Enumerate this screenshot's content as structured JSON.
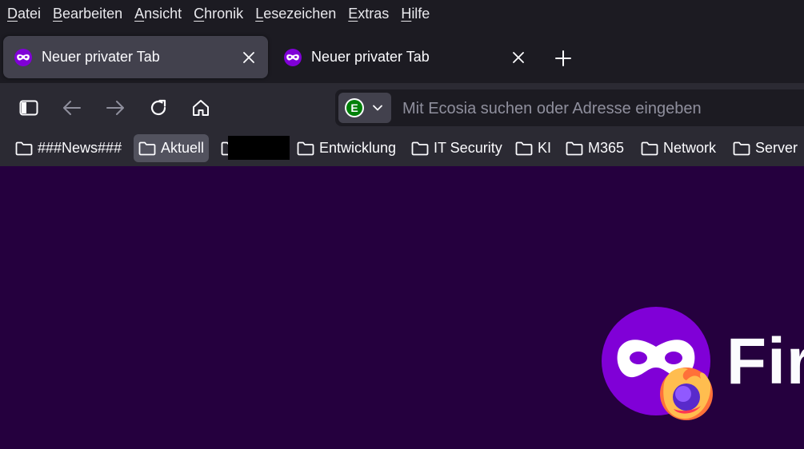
{
  "menubar": {
    "items": [
      {
        "accel": "D",
        "rest": "atei"
      },
      {
        "accel": "B",
        "rest": "earbeiten"
      },
      {
        "accel": "A",
        "rest": "nsicht"
      },
      {
        "accel": "C",
        "rest": "hronik"
      },
      {
        "accel": "L",
        "rest": "esezeichen"
      },
      {
        "accel": "E",
        "rest": "xtras"
      },
      {
        "accel": "H",
        "rest": "ilfe"
      }
    ]
  },
  "tabs": [
    {
      "title": "Neuer privater Tab",
      "active": true
    },
    {
      "title": "Neuer privater Tab",
      "active": false
    }
  ],
  "urlbar": {
    "placeholder": "Mit Ecosia suchen oder Adresse eingeben",
    "engine_letter": "E"
  },
  "bookmarks": [
    {
      "label": "###News###"
    },
    {
      "label": "Aktuell"
    },
    {
      "label": ""
    },
    {
      "label": "Entwicklung"
    },
    {
      "label": "IT Security"
    },
    {
      "label": "KI"
    },
    {
      "label": "M365"
    },
    {
      "label": "Network"
    },
    {
      "label": "Server"
    }
  ],
  "content": {
    "brand_word": "Fir"
  },
  "colors": {
    "chrome_bg": "#1c1b22",
    "toolbar_bg": "#2b2a33",
    "active_tab": "#42414d",
    "private_bg": "#25003e",
    "private_purple": "#8000d7",
    "ecosia_green": "#008009"
  }
}
